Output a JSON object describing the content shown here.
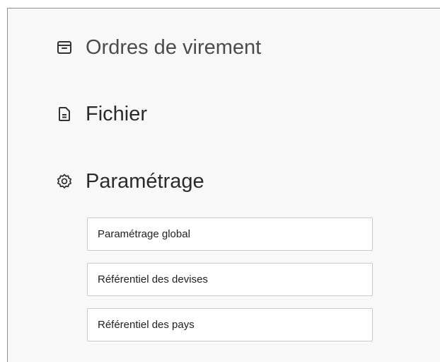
{
  "menu": {
    "sections": [
      {
        "label": "Ordres de virement",
        "icon": "archive-box-icon"
      },
      {
        "label": "Fichier",
        "icon": "document-icon"
      },
      {
        "label": "Paramétrage",
        "icon": "gear-icon"
      }
    ],
    "parametrage_items": [
      {
        "label": "Paramétrage global"
      },
      {
        "label": "Référentiel des devises"
      },
      {
        "label": "Référentiel des pays"
      }
    ]
  },
  "colors": {
    "panel_background": "#f8f8f8",
    "item_background": "#ffffff",
    "item_border": "#c8c8c8",
    "text": "#2b2b2b"
  }
}
